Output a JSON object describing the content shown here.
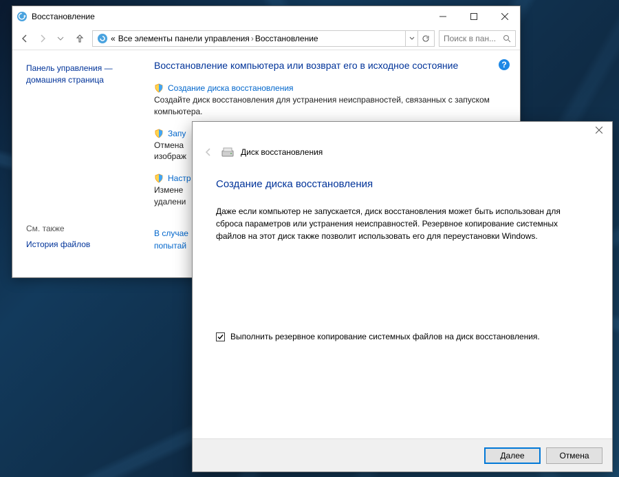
{
  "win1": {
    "title": "Восстановление",
    "breadcrumb": {
      "chev": "«",
      "part1": "Все элементы панели управления",
      "part2": "Восстановление"
    },
    "search_placeholder": "Поиск в пан...",
    "side": {
      "home1": "Панель управления —",
      "home2": "домашняя страница",
      "see_also": "См. также",
      "history": "История файлов"
    },
    "main": {
      "heading": "Восстановление компьютера или возврат его в исходное состояние",
      "items": [
        {
          "link": "Создание диска восстановления",
          "desc": "Создайте диск восстановления для устранения неисправностей, связанных с запуском компьютера."
        },
        {
          "link": "Запу",
          "desc": "Отмена\nизображ"
        },
        {
          "link": "Настр",
          "desc": "Измене\nудалени"
        }
      ],
      "footer_l1": "В случае",
      "footer_l2": "попытай"
    }
  },
  "win2": {
    "hdr": "Диск восстановления",
    "title": "Создание диска восстановления",
    "para": "Даже если компьютер не запускается, диск восстановления может быть использован для сброса параметров или устранения неисправностей. Резервное копирование системных файлов на этот диск также позволит использовать его для переустановки Windows.",
    "checkbox": "Выполнить резервное копирование системных файлов на диск восстановления.",
    "btn_next": "Далее",
    "btn_cancel": "Отмена"
  }
}
